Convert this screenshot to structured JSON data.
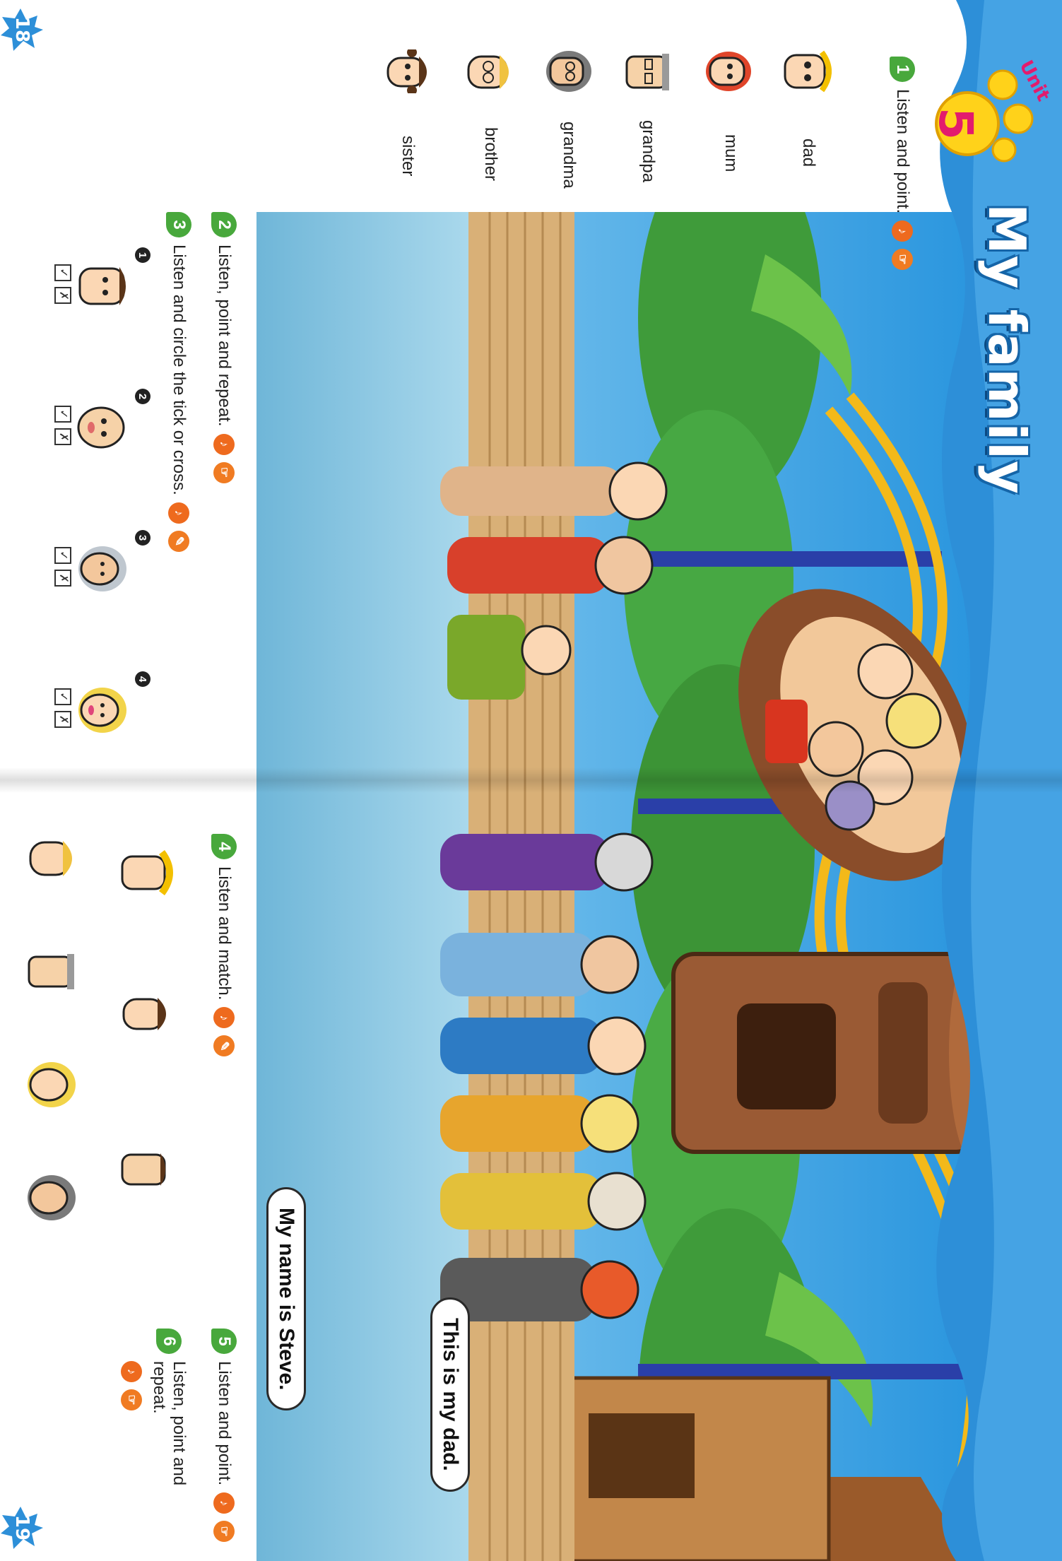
{
  "header": {
    "unit_label": "Unit",
    "unit_number": "5",
    "title": "My family"
  },
  "icons": {
    "listen": "ear-icon",
    "point": "hand-icon",
    "track": "cd-icon"
  },
  "colors": {
    "title_blue": "#2d8fd8",
    "exercise_green": "#48a83c",
    "audio_orange": "#f07b22",
    "unit_pink": "#e31b6d",
    "badge_yellow": "#ffd21a"
  },
  "exercises": [
    {
      "number": "1",
      "text": "Listen and point."
    },
    {
      "number": "2",
      "text": "Listen, point and repeat."
    },
    {
      "number": "3",
      "text": "Listen and circle the tick or cross."
    },
    {
      "number": "4",
      "text": "Listen and match."
    },
    {
      "number": "5",
      "text": "Listen and point."
    },
    {
      "number": "6",
      "text": "Listen, point and repeat."
    }
  ],
  "vocabulary": [
    "dad",
    "mum",
    "grandpa",
    "grandma",
    "brother",
    "sister"
  ],
  "tick_cross": {
    "items": [
      {
        "number": "1",
        "tick": "✓",
        "cross": "✗"
      },
      {
        "number": "2",
        "tick": "✓",
        "cross": "✗"
      },
      {
        "number": "3",
        "tick": "✓",
        "cross": "✗"
      },
      {
        "number": "4",
        "tick": "✓",
        "cross": "✗"
      }
    ]
  },
  "speech_bubbles": [
    "This is my dad.",
    "My name is Steve."
  ],
  "page_numbers": {
    "left": "18",
    "right": "19"
  }
}
